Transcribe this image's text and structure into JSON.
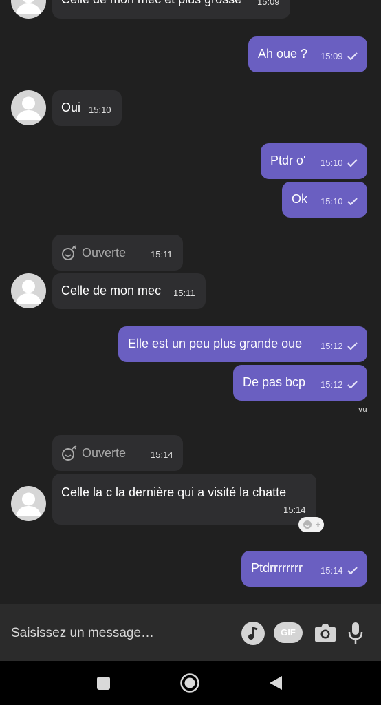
{
  "messages": [
    {
      "text": "Celle de mon mec et plus grosse",
      "time": "15:09"
    },
    {
      "text": "Ah oue ?",
      "time": "15:09"
    },
    {
      "text": "Oui",
      "time": "15:10"
    },
    {
      "text": "Ptdr o'",
      "time": "15:10"
    },
    {
      "text": "Ok",
      "time": "15:10"
    },
    {
      "text": "Ouverte",
      "time": "15:11"
    },
    {
      "text": "Celle de mon mec",
      "time": "15:11"
    },
    {
      "text": "Elle est un peu plus grande oue",
      "time": "15:12"
    },
    {
      "text": "De pas bcp",
      "time": "15:12"
    },
    {
      "text": "Ouverte",
      "time": "15:14"
    },
    {
      "text": "Celle la c la dernière qui a visité la chatte",
      "time": "15:14"
    },
    {
      "text": "Ptdrrrrrrrr",
      "time": "15:14"
    }
  ],
  "seen_label": "vu",
  "composer": {
    "placeholder": "Saisissez un message…",
    "gif_label": "GIF",
    "icons": [
      "music-note-icon",
      "gif-icon",
      "camera-icon",
      "microphone-icon"
    ]
  },
  "navbar": {
    "icons": [
      "recents-square-icon",
      "home-circle-icon",
      "back-triangle-icon"
    ]
  },
  "colors": {
    "background": "#202020",
    "incoming_bubble": "#2e2e30",
    "outgoing_bubble": "#6a5fc1",
    "composer": "#2b2b2b"
  }
}
